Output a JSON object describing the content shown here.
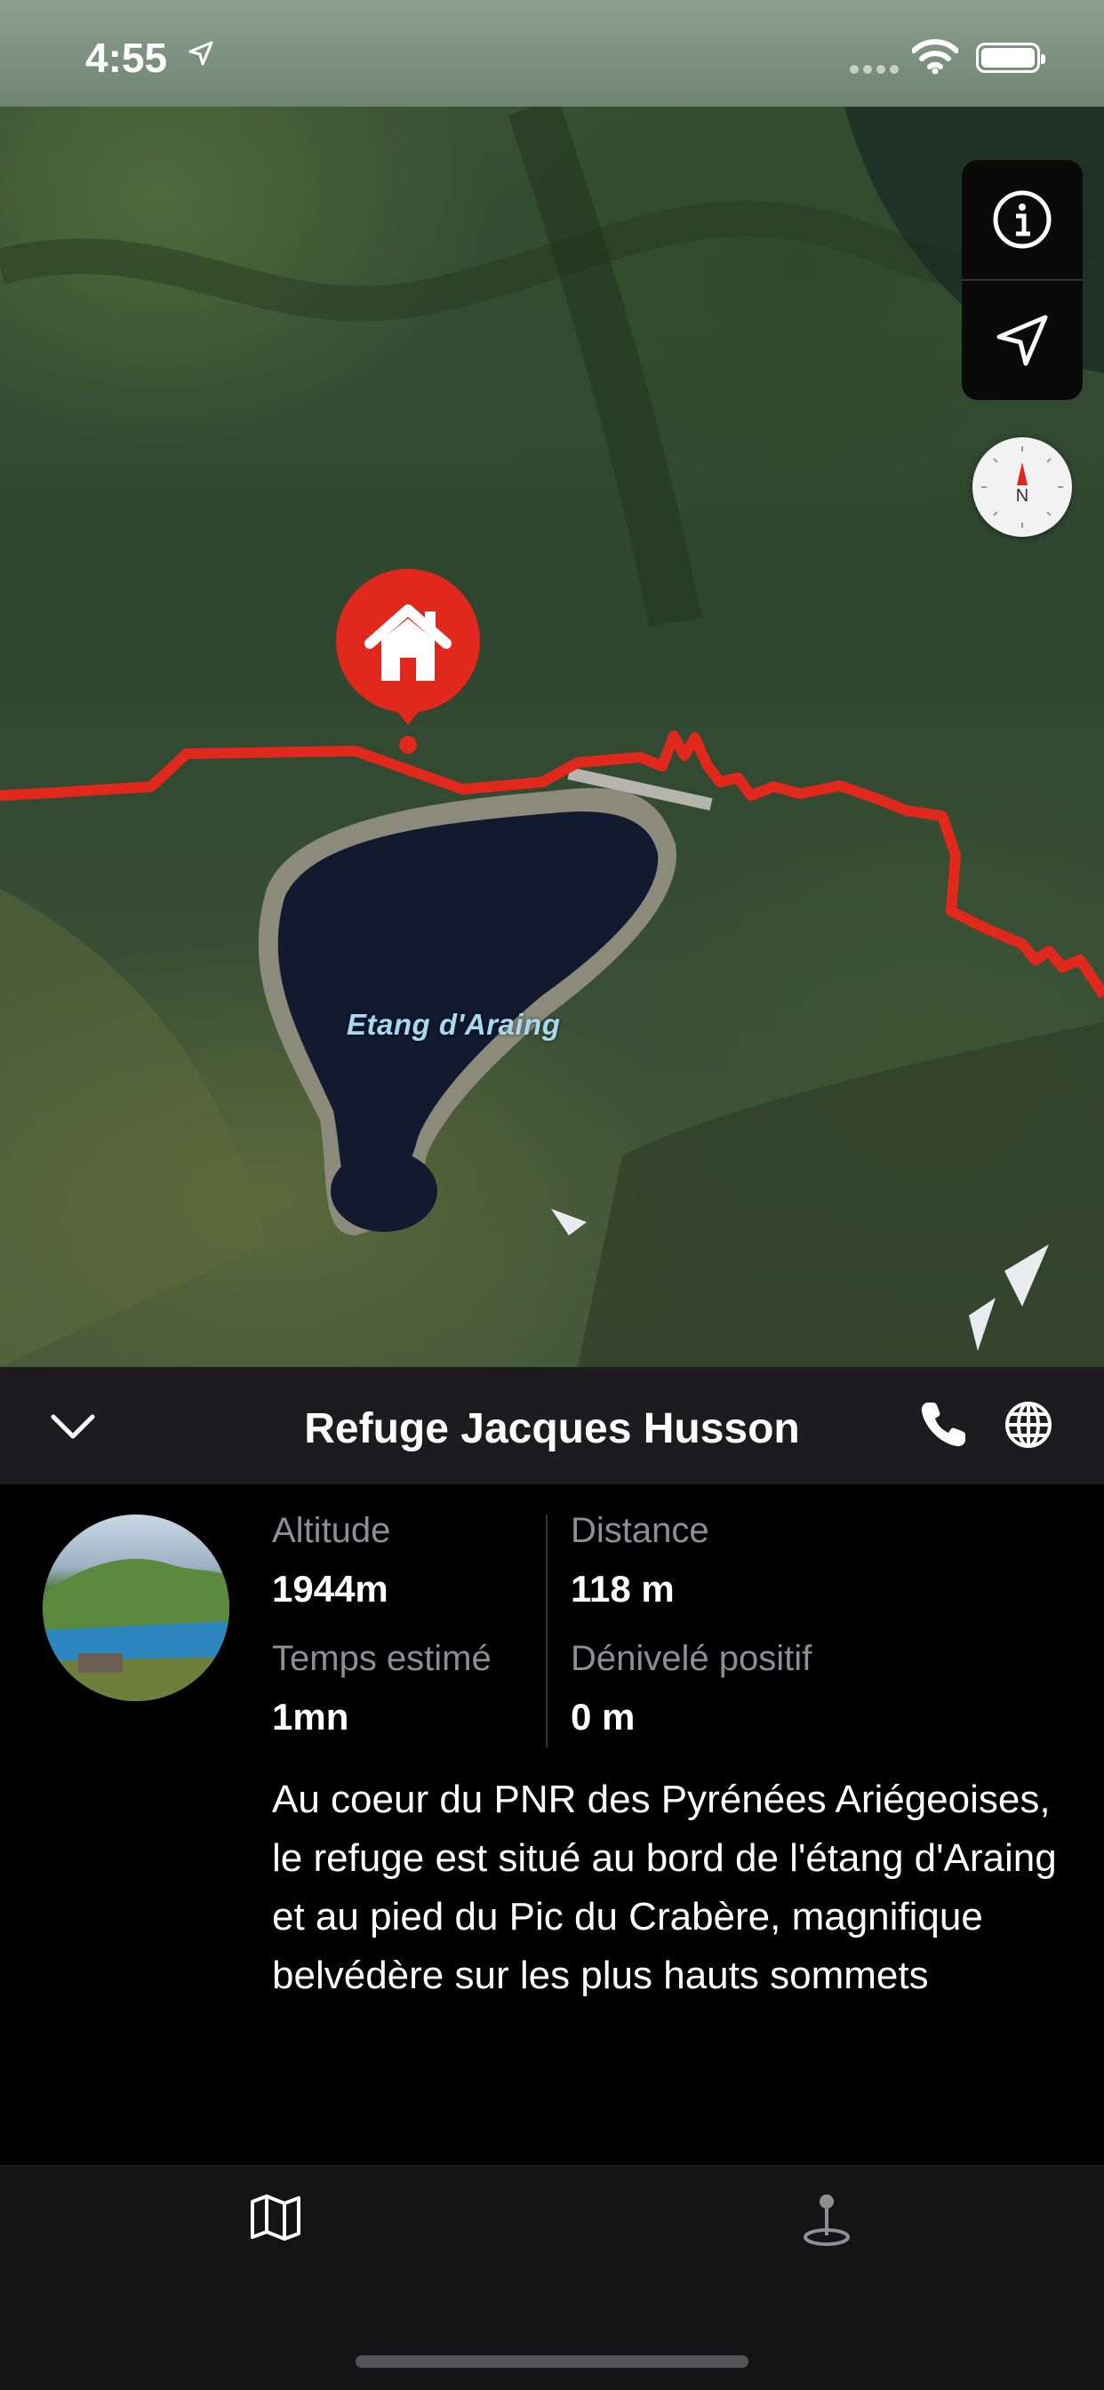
{
  "status_bar": {
    "time": "4:55"
  },
  "map": {
    "lake_label": "Etang d'Araing",
    "controls": {
      "info_icon": "info-icon",
      "location_icon": "location-arrow-icon",
      "compass_icon": "compass-icon"
    },
    "pin_icon": "house-icon",
    "route_color": "#e0281c"
  },
  "sheet": {
    "title": "Refuge Jacques Husson",
    "collapse_icon": "chevron-down-icon",
    "phone_icon": "phone-icon",
    "web_icon": "globe-icon"
  },
  "details": {
    "stats": [
      {
        "label": "Altitude",
        "value": "1944m"
      },
      {
        "label": "Distance",
        "value": "118 m"
      },
      {
        "label": "Temps estimé",
        "value": "1mn"
      },
      {
        "label": "Dénivelé positif",
        "value": "0 m"
      }
    ],
    "description": "Au coeur du PNR des Pyrénées Ariégeoises, le refuge est situé au bord de l'étang d'Araing et au pied du Pic du Crabère, magnifique belvédère sur les plus hauts sommets"
  },
  "tabbar": {
    "map_icon": "map-icon",
    "places_icon": "pin-icon"
  }
}
